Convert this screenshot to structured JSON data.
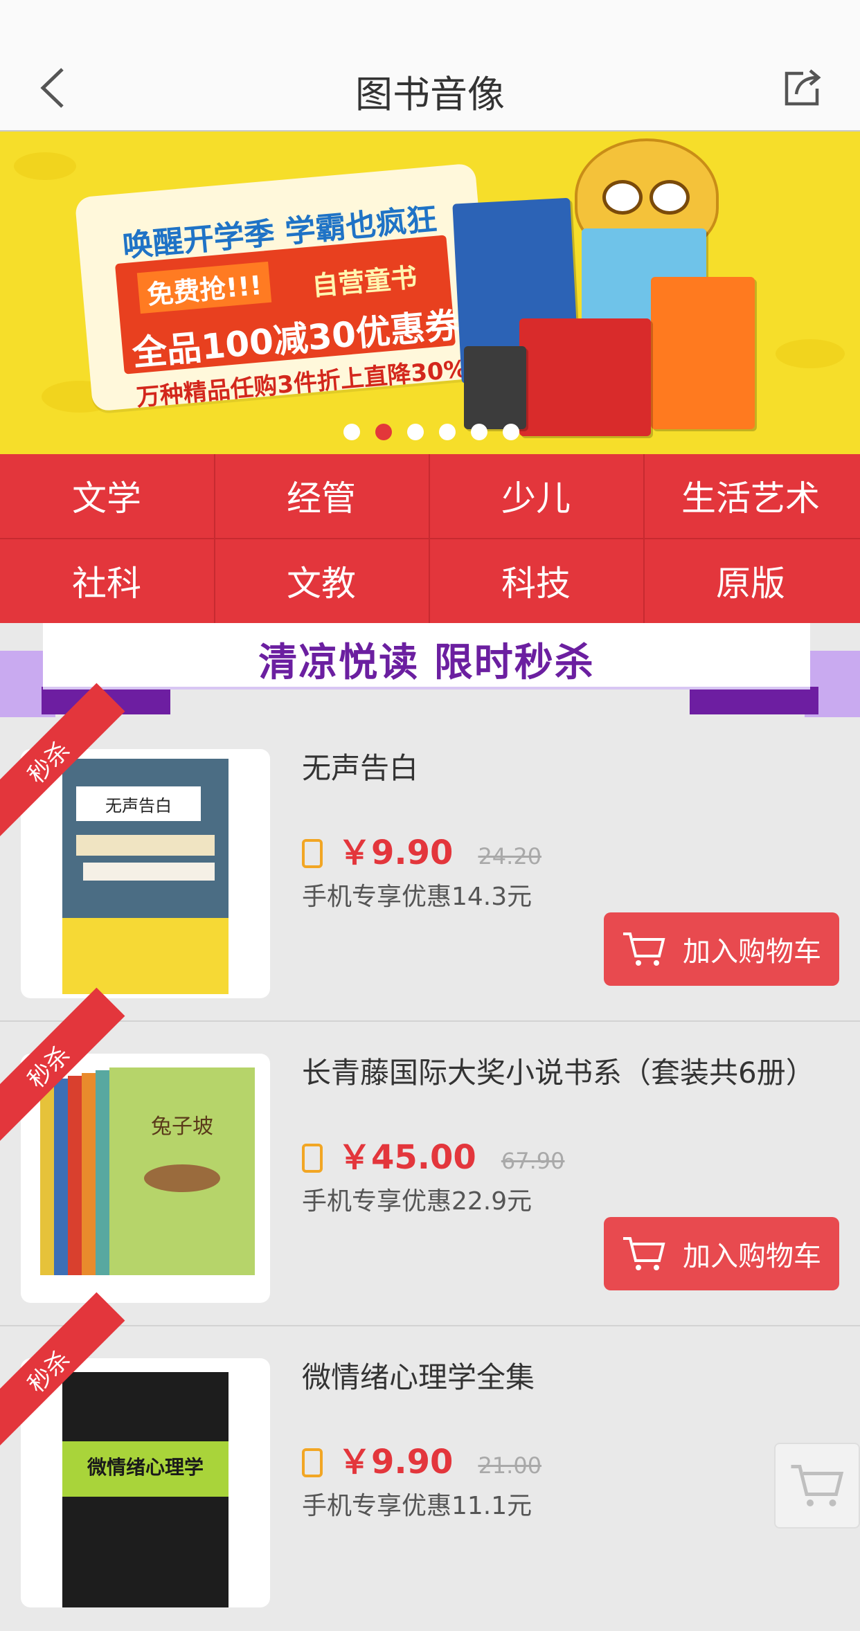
{
  "header": {
    "title": "图书音像"
  },
  "banner": {
    "headline": "唤醒开学季 学霸也疯狂",
    "free_tag": "免费抢!!!",
    "self_tag": "自营童书",
    "main_offer": "全品100减30优惠券",
    "sub_offer": "万种精品任购3件折上直降30%",
    "slides": 6,
    "active_slide": 2
  },
  "categories": [
    "文学",
    "经管",
    "少儿",
    "生活艺术",
    "社科",
    "文教",
    "科技",
    "原版"
  ],
  "promo": {
    "title": "清凉悦读 限时秒杀"
  },
  "products": [
    {
      "badge": "秒杀",
      "title": "无声告白",
      "price": "￥9.90",
      "old_price": "24.20",
      "discount": "手机专享优惠14.3元",
      "cart_label": "加入购物车",
      "cover": "无声告白"
    },
    {
      "badge": "秒杀",
      "title": "长青藤国际大奖小说书系（套装共6册）",
      "price": "￥45.00",
      "old_price": "67.90",
      "discount": "手机专享优惠22.9元",
      "cart_label": "加入购物车",
      "cover": "兔子坡"
    },
    {
      "badge": "秒杀",
      "title": "微情绪心理学全集",
      "price": "￥9.90",
      "old_price": "21.00",
      "discount": "手机专享优惠11.1元",
      "cart_label": "加入购物车",
      "cover": "微情绪心理学"
    }
  ],
  "colors": {
    "accent": "#e3363c",
    "promo_purple": "#6b1fa0",
    "banner_yellow": "#f6de2a"
  }
}
